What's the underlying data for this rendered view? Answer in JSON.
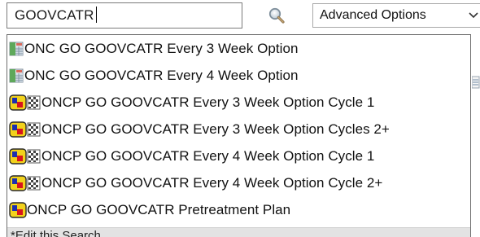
{
  "search": {
    "value": "GOOVCATR",
    "search_button_icon": "magnifier-icon"
  },
  "advanced": {
    "label": "Advanced Options",
    "chevron_icon": "chevron-down-icon"
  },
  "results": [
    {
      "icon": "order-set-icon",
      "label": "ONC GO GOOVCATR Every 3 Week Option"
    },
    {
      "icon": "order-set-icon",
      "label": "ONC GO GOOVCATR Every 4 Week Option"
    },
    {
      "icon": "treatment-plan-icon",
      "label": "ONCP GO GOOVCATR Every 3 Week Option Cycle 1"
    },
    {
      "icon": "treatment-plan-icon",
      "label": "ONCP GO GOOVCATR Every 3 Week Option Cycles 2+"
    },
    {
      "icon": "treatment-plan-icon",
      "label": "ONCP GO GOOVCATR Every 4 Week Option Cycle 1"
    },
    {
      "icon": "treatment-plan-icon",
      "label": "ONCP GO GOOVCATR Every 4 Week Option Cycle 2+"
    },
    {
      "icon": "therapy-plan-icon",
      "label": "ONCP GO GOOVCATR Pretreatment Plan"
    }
  ],
  "footer": {
    "label": "*Edit this Search"
  },
  "colors": {
    "cycle_icon_yellow": "#f2d21c",
    "cycle_icon_blue": "#1c2fb0",
    "cycle_icon_red": "#d8141c",
    "sheet_icon_green": "#4f9a4a"
  }
}
